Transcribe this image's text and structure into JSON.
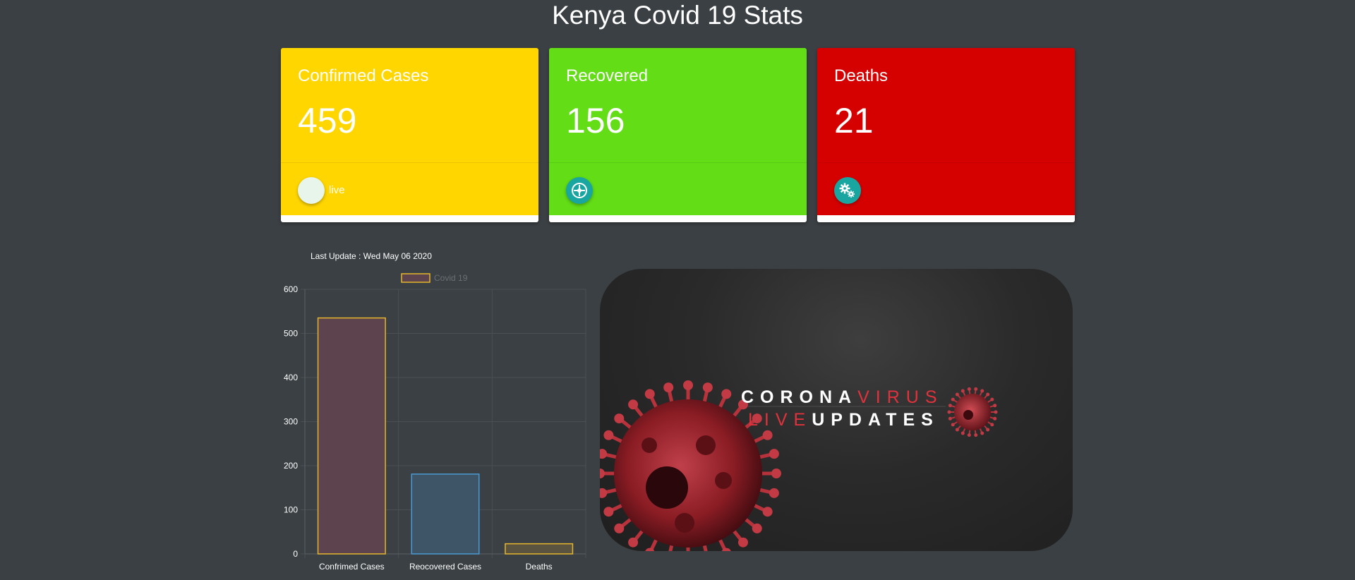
{
  "page": {
    "title": "Kenya Covid 19 Stats"
  },
  "cards": [
    {
      "label": "Confirmed Cases",
      "value": "459",
      "color": "#ffd600",
      "footer_icon": "live-toggle-icon",
      "footer_text": "live"
    },
    {
      "label": "Recovered",
      "value": "156",
      "color": "#62dd16",
      "footer_icon": "hospital-icon"
    },
    {
      "label": "Deaths",
      "value": "21",
      "color": "#d50000",
      "footer_icon": "gears-icon"
    }
  ],
  "last_update": "Last Update : Wed May 06 2020",
  "banner": {
    "line1_a": "CORONA",
    "line1_b": "VIRUS",
    "line2_a": "LIVE",
    "line2_b": "UPDATES",
    "accent_color": "#e0323c"
  },
  "chart_data": {
    "type": "bar",
    "categories": [
      "Confrimed Cases",
      "Reocovered Cases",
      "Deaths"
    ],
    "series": [
      {
        "name": "Covid 19",
        "values": [
          535,
          181,
          23
        ]
      }
    ],
    "bar_fill_colors": [
      "#5d434d",
      "#3d5566",
      "#5a5340"
    ],
    "bar_border_colors": [
      "#e5b62d",
      "#4a9ad2",
      "#e5b62d"
    ],
    "legend_color": "#e5b62d",
    "ylim": [
      0,
      600
    ],
    "yticks": [
      0,
      100,
      200,
      300,
      400,
      500,
      600
    ],
    "grid": true,
    "legend_position": "top"
  }
}
